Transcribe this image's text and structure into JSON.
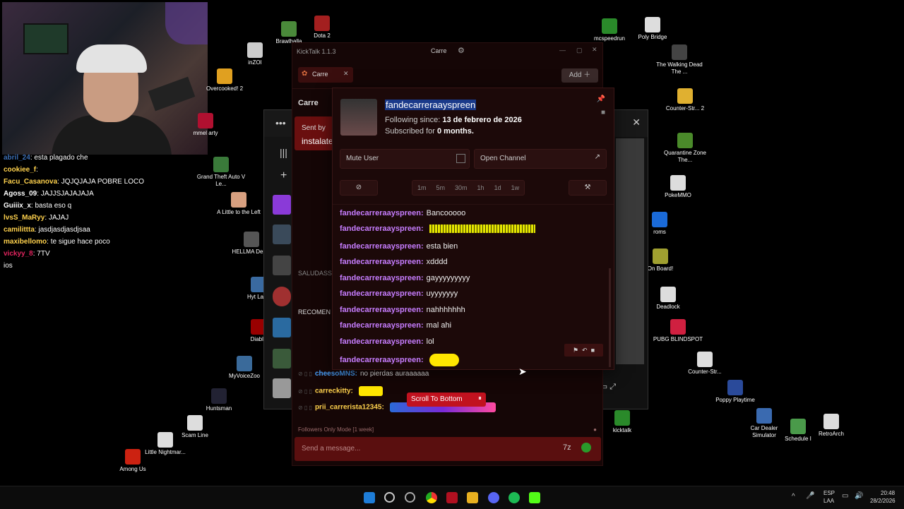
{
  "chat_overlay": [
    {
      "name": "abril_24",
      "msg": "esta plagado che",
      "color": "#3c6eb4"
    },
    {
      "name": "cookiee_f",
      "msg": "",
      "color": "#ffd24d"
    },
    {
      "name": "Facu_Casanova",
      "msg": "JQJQJAJA POBRE LOCO",
      "color": "#ffd24d"
    },
    {
      "name": "Agoss_09",
      "msg": "JAJJSJAJAJAJA",
      "color": "#ffffff"
    },
    {
      "name": "Guiiix_x",
      "msg": "basta eso q",
      "color": "#ffffff"
    },
    {
      "name": "lvsS_MaRyy",
      "msg": "JAJAJ",
      "color": "#ffd24d"
    },
    {
      "name": "camilittta",
      "msg": "jasdjasdjasdjsaa",
      "color": "#ffd24d"
    },
    {
      "name": "maxibellomo",
      "msg": "te sigue hace poco",
      "color": "#ffd24d"
    },
    {
      "name": "vickyy_8",
      "msg": "7TV",
      "color": "#e0245e"
    },
    {
      "name": "",
      "msg": "ios",
      "color": "#ffffff"
    }
  ],
  "desktop_icons": [
    {
      "label": "Brawlhalla",
      "color": "#4a8a3a"
    },
    {
      "label": "Dota 2",
      "color": "#a31f1f"
    },
    {
      "label": "inZOI",
      "color": "#ccc"
    },
    {
      "label": "Overcooked! 2",
      "color": "#e0a020"
    },
    {
      "label": "mmel arty",
      "color": "#b01030"
    },
    {
      "label": "Grand Theft Auto V Le...",
      "color": "#3a7a3a"
    },
    {
      "label": "A Little to the Left",
      "color": "#d8a080"
    },
    {
      "label": "HELLMA Demo",
      "color": "#555"
    },
    {
      "label": "Hyt Laun",
      "color": "#3a6aa0"
    },
    {
      "label": "Diablo",
      "color": "#900"
    },
    {
      "label": "MyVoiceZoo",
      "color": "#3a6a9a"
    },
    {
      "label": "Huntsman",
      "color": "#223"
    },
    {
      "label": "Scam Line",
      "color": "#ddd"
    },
    {
      "label": "Little Nightmar...",
      "color": "#ddd"
    },
    {
      "label": "Among Us",
      "color": "#c21"
    },
    {
      "label": "mcspeedrun",
      "color": "#2a8a2a"
    },
    {
      "label": "Poly Bridge",
      "color": "#ddd"
    },
    {
      "label": "The Walking Dead The ...",
      "color": "#444"
    },
    {
      "label": "Counter-Str... 2",
      "color": "#e0b030"
    },
    {
      "label": "Quarantine Zone The...",
      "color": "#4a8a2a"
    },
    {
      "label": "PokeMMO",
      "color": "#ddd"
    },
    {
      "label": "roms",
      "color": "#1a6ad8"
    },
    {
      "label": "On Board!",
      "color": "#a0a030"
    },
    {
      "label": "Deadlock",
      "color": "#ddd"
    },
    {
      "label": "PUBG BLINDSPOT",
      "color": "#d02040"
    },
    {
      "label": "Counter-Str...",
      "color": "#ddd"
    },
    {
      "label": "Poppy Playtime",
      "color": "#2a4a9a"
    },
    {
      "label": "Car Dealer Simulator",
      "color": "#3a6ab0"
    },
    {
      "label": "Schedule I",
      "color": "#4a9a4a"
    },
    {
      "label": "RetroArch",
      "color": "#ddd"
    },
    {
      "label": "kicktalk",
      "color": "#2a8a2a"
    }
  ],
  "kicktalk": {
    "title": "KickTalk 1.1.3",
    "center_tab": "Carre",
    "channel_tab": "Carre",
    "add_label": "Add",
    "channel_header": "Carre",
    "sent_by": "Sent by",
    "install_text": "instalate",
    "side_text1": "SALUDASS",
    "side_text2": "RECOMEN",
    "bottom_msgs": [
      {
        "name": "cheesoMNS:",
        "msg": "no pierdas auraaaaaa",
        "color": "#4aa3ff"
      },
      {
        "name": "carreckitty:",
        "msg": "",
        "color": "#ffd24d"
      },
      {
        "name": "prii_carrerista12345:",
        "msg": "",
        "color": "#ffd24d"
      }
    ],
    "scroll_bottom": "Scroll To Bottom",
    "followers_mode": "Followers Only Mode [1 week]",
    "input_placeholder": "Send a message..."
  },
  "usercard": {
    "username": "fandecarreraayspreen",
    "following_label": "Following since:",
    "following_date": "13 de febrero de 2026",
    "subscribed_label": "Subscribed for",
    "subscribed_value": "0 months.",
    "mute_label": "Mute User",
    "open_channel_label": "Open Channel",
    "timeouts": [
      "1m",
      "5m",
      "30m",
      "1h",
      "1d",
      "1w"
    ],
    "messages": [
      {
        "name": "fandecarreraayspreen:",
        "text": "Bancooooo",
        "emote": ""
      },
      {
        "name": "fandecarreraayspreen:",
        "text": "",
        "emote": "eq"
      },
      {
        "name": "fandecarreraayspreen:",
        "text": "esta bien",
        "emote": ""
      },
      {
        "name": "fandecarreraayspreen:",
        "text": "xdddd",
        "emote": ""
      },
      {
        "name": "fandecarreraayspreen:",
        "text": "gayyyyyyyyy",
        "emote": ""
      },
      {
        "name": "fandecarreraayspreen:",
        "text": "uyyyyyyy",
        "emote": ""
      },
      {
        "name": "fandecarreraayspreen:",
        "text": "nahhhhhhh",
        "emote": ""
      },
      {
        "name": "fandecarreraayspreen:",
        "text": "mal ahi",
        "emote": ""
      },
      {
        "name": "fandecarreraayspreen:",
        "text": "lol",
        "emote": ""
      },
      {
        "name": "fandecarreraayspreen:",
        "text": "",
        "emote": "pepe"
      }
    ]
  },
  "taskbar": {
    "lang1": "ESP",
    "lang2": "LAA",
    "time": "20:48",
    "date": "28/2/2026"
  },
  "colors": {
    "accent": "#c77dff",
    "kick_green": "#53fc18",
    "panel": "#1c0909"
  }
}
